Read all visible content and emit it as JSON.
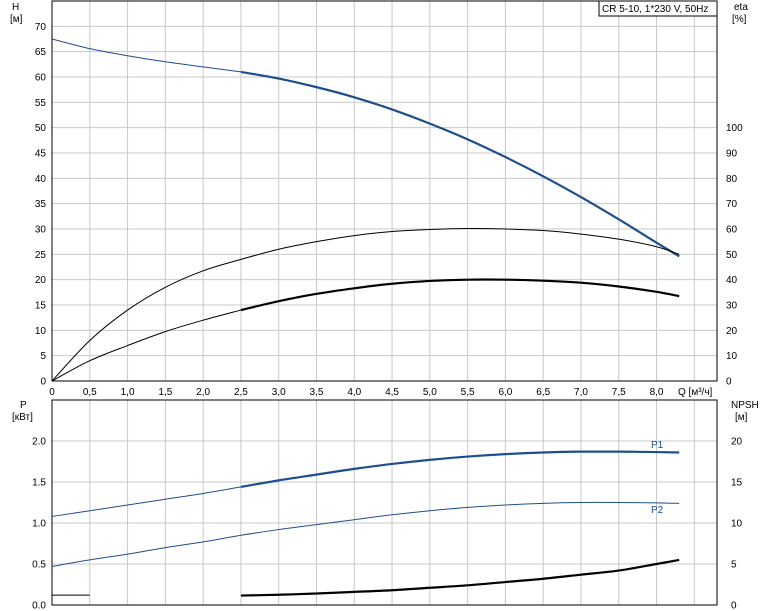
{
  "chart_data": [
    {
      "type": "line",
      "title": "CR 5-10, 1*230 V, 50Hz",
      "xlabel": "Q [м³/ч]",
      "ylabel": "H",
      "ylabel_unit": "[м]",
      "y2label": "eta",
      "y2label_unit": "[%]",
      "xlim": [
        0,
        8.8
      ],
      "ylim": [
        0,
        75
      ],
      "y2lim": [
        0,
        150
      ],
      "xticks": [
        "0",
        "0,5",
        "1,0",
        "1,5",
        "2,0",
        "2,5",
        "3,0",
        "3,5",
        "4,0",
        "4,5",
        "5,0",
        "5,5",
        "6,0",
        "6,5",
        "7,0",
        "7,5",
        "8,0"
      ],
      "yticks": [
        "0",
        "5",
        "10",
        "15",
        "20",
        "25",
        "30",
        "35",
        "40",
        "45",
        "50",
        "55",
        "60",
        "65",
        "70"
      ],
      "y2ticks": [
        "0",
        "10",
        "20",
        "30",
        "40",
        "50",
        "60",
        "70",
        "80",
        "90",
        "100"
      ],
      "grid": true,
      "series": [
        {
          "axis": "left",
          "color": "#1f4e8c",
          "x": [
            0,
            0.5,
            1.0,
            1.5,
            2.0,
            2.5,
            3.0,
            3.5,
            4.0,
            4.5,
            5.0,
            5.5,
            6.0,
            6.5,
            7.0,
            7.5,
            8.0,
            8.3
          ],
          "y": [
            67.5,
            65.6,
            64.2,
            63.0,
            62.0,
            61.0,
            59.7,
            58.0,
            56.0,
            53.6,
            50.8,
            47.7,
            44.2,
            40.4,
            36.3,
            31.9,
            27.3,
            24.6
          ],
          "bold_from": 2.5
        },
        {
          "axis": "right",
          "color": "#000000",
          "x": [
            0,
            0.5,
            1.0,
            1.5,
            2.0,
            2.5,
            3.0,
            3.5,
            4.0,
            4.5,
            5.0,
            5.5,
            6.0,
            6.5,
            7.0,
            7.5,
            8.0,
            8.3
          ],
          "y": [
            0,
            16,
            28,
            37,
            43.5,
            48,
            52,
            55,
            57.4,
            59,
            59.8,
            60.2,
            60,
            59.4,
            58,
            56,
            53,
            50
          ],
          "bold_from": 99
        },
        {
          "axis": "right",
          "color": "#000000",
          "x": [
            0,
            0.5,
            1.0,
            1.5,
            2.0,
            2.5,
            3.0,
            3.5,
            4.0,
            4.5,
            5.0,
            5.5,
            6.0,
            6.5,
            7.0,
            7.5,
            8.0,
            8.3
          ],
          "y": [
            0,
            8,
            14,
            19.5,
            24,
            28,
            31.5,
            34.4,
            36.6,
            38.4,
            39.5,
            40,
            40,
            39.6,
            38.8,
            37.3,
            35.2,
            33.5
          ],
          "bold_from": 2.5
        }
      ]
    },
    {
      "type": "line",
      "xlabel": "",
      "ylabel": "P",
      "ylabel_unit": "[кВт]",
      "y2label": "NPSH",
      "y2label_unit": "[м]",
      "xlim": [
        0,
        8.8
      ],
      "ylim": [
        0,
        2.5
      ],
      "y2lim": [
        0,
        25
      ],
      "yticks": [
        "0.0",
        "0.5",
        "1.0",
        "1.5",
        "2.0"
      ],
      "y2ticks": [
        "0",
        "5",
        "10",
        "15",
        "20"
      ],
      "grid": true,
      "series": [
        {
          "name": "P1",
          "axis": "left",
          "color": "#1f4e8c",
          "x": [
            0,
            0.5,
            1.0,
            1.5,
            2.0,
            2.5,
            3.0,
            3.5,
            4.0,
            4.5,
            5.0,
            5.5,
            6.0,
            6.5,
            7.0,
            7.5,
            8.0,
            8.3
          ],
          "y": [
            1.08,
            1.15,
            1.22,
            1.29,
            1.36,
            1.44,
            1.52,
            1.59,
            1.66,
            1.72,
            1.77,
            1.81,
            1.84,
            1.86,
            1.87,
            1.87,
            1.865,
            1.86
          ],
          "bold_from": 2.5
        },
        {
          "name": "P2",
          "axis": "left",
          "color": "#1f4e8c",
          "x": [
            0,
            0.5,
            1.0,
            1.5,
            2.0,
            2.5,
            3.0,
            3.5,
            4.0,
            4.5,
            5.0,
            5.5,
            6.0,
            6.5,
            7.0,
            7.5,
            8.0,
            8.3
          ],
          "y": [
            0.47,
            0.55,
            0.62,
            0.7,
            0.77,
            0.85,
            0.92,
            0.98,
            1.04,
            1.1,
            1.15,
            1.19,
            1.22,
            1.24,
            1.25,
            1.25,
            1.245,
            1.24
          ],
          "bold_from": 99
        },
        {
          "axis": "right",
          "color": "#000000",
          "x": [
            0,
            0.5,
            1.0,
            1.5,
            2.5,
            3.0,
            3.5,
            4.0,
            4.5,
            5.0,
            5.5,
            6.0,
            6.5,
            7.0,
            7.5,
            8.0,
            8.3
          ],
          "y": [
            1.2,
            1.2,
            1.2,
            1.15,
            1.15,
            1.25,
            1.4,
            1.6,
            1.8,
            2.1,
            2.4,
            2.8,
            3.2,
            3.7,
            4.2,
            5.0,
            5.5
          ],
          "bold_from": 2.5,
          "gap_after": 0.6
        }
      ]
    }
  ]
}
